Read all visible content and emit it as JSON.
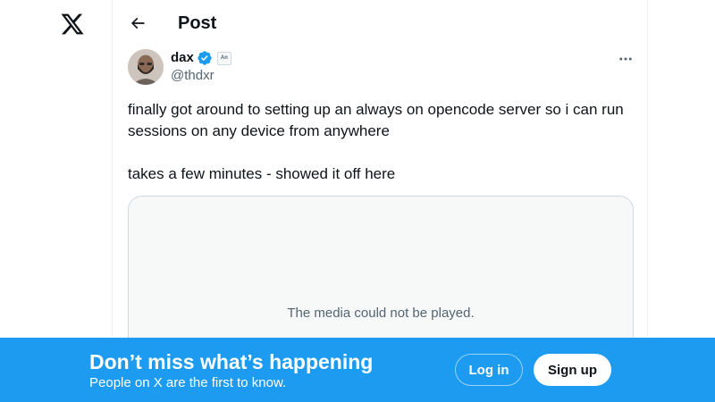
{
  "header": {
    "title": "Post"
  },
  "post": {
    "author": {
      "name": "dax",
      "handle": "@thdxr",
      "badge_label": "An"
    },
    "text_lines": [
      "finally got around to setting up an always on opencode server so i can run sessions on any device from anywhere",
      "takes a few minutes - showed it off here"
    ],
    "media_message": "The media could not be played."
  },
  "banner": {
    "title": "Don’t miss what’s happening",
    "subtitle": "People on X are the first to know.",
    "login_label": "Log in",
    "signup_label": "Sign up"
  },
  "icons": {
    "logo": "x-logo",
    "back": "arrow-left-icon",
    "verified": "verified-badge-icon",
    "more": "more-horizontal-icon"
  },
  "colors": {
    "accent": "#1d9bf0",
    "text_primary": "#0f1419",
    "text_secondary": "#536471",
    "border": "#cfd9de"
  }
}
